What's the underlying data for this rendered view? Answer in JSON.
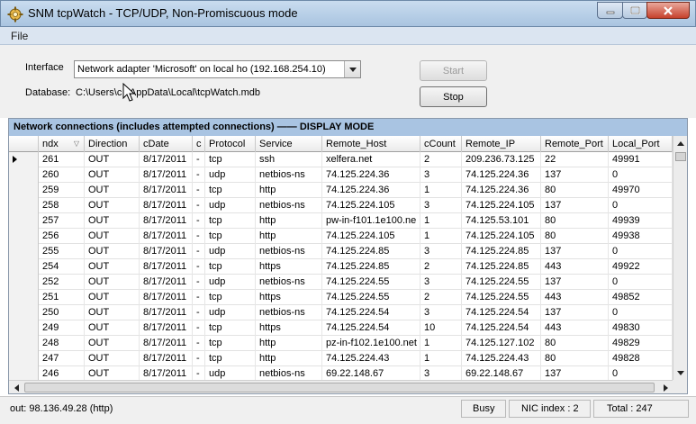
{
  "window": {
    "title": "SNM tcpWatch - TCP/UDP, Non-Promiscuous mode",
    "icons": {
      "app": "network-gear-icon",
      "minimize": "minimize-icon",
      "maximize": "maximize-icon",
      "close": "close-icon"
    }
  },
  "menu": {
    "file": "File"
  },
  "panel": {
    "interface_label": "Interface",
    "interface_value": "Network adapter 'Microsoft' on local ho (192.168.254.10)",
    "database_label": "Database:",
    "database_value": "C:\\Users\\c  i\\AppData\\Local\\tcpWatch.mdb",
    "start_label": "Start",
    "stop_label": "Stop"
  },
  "grid": {
    "caption": "Network connections (includes attempted connections)  ——  DISPLAY MODE",
    "columns": [
      "ndx",
      "Direction",
      "cDate",
      "c",
      "Protocol",
      "Service",
      "Remote_Host",
      "cCount",
      "Remote_IP",
      "Remote_Port",
      "Local_Port"
    ],
    "rows": [
      [
        "261",
        "OUT",
        "8/17/2011",
        "-",
        "tcp",
        "ssh",
        "xelfera.net",
        "2",
        "209.236.73.125",
        "22",
        "49991"
      ],
      [
        "260",
        "OUT",
        "8/17/2011",
        "-",
        "udp",
        "netbios-ns",
        "74.125.224.36",
        "3",
        "74.125.224.36",
        "137",
        "0"
      ],
      [
        "259",
        "OUT",
        "8/17/2011",
        "-",
        "tcp",
        "http",
        "74.125.224.36",
        "1",
        "74.125.224.36",
        "80",
        "49970"
      ],
      [
        "258",
        "OUT",
        "8/17/2011",
        "-",
        "udp",
        "netbios-ns",
        "74.125.224.105",
        "3",
        "74.125.224.105",
        "137",
        "0"
      ],
      [
        "257",
        "OUT",
        "8/17/2011",
        "-",
        "tcp",
        "http",
        "pw-in-f101.1e100.ne",
        "1",
        "74.125.53.101",
        "80",
        "49939"
      ],
      [
        "256",
        "OUT",
        "8/17/2011",
        "-",
        "tcp",
        "http",
        "74.125.224.105",
        "1",
        "74.125.224.105",
        "80",
        "49938"
      ],
      [
        "255",
        "OUT",
        "8/17/2011",
        "-",
        "udp",
        "netbios-ns",
        "74.125.224.85",
        "3",
        "74.125.224.85",
        "137",
        "0"
      ],
      [
        "254",
        "OUT",
        "8/17/2011",
        "-",
        "tcp",
        "https",
        "74.125.224.85",
        "2",
        "74.125.224.85",
        "443",
        "49922"
      ],
      [
        "252",
        "OUT",
        "8/17/2011",
        "-",
        "udp",
        "netbios-ns",
        "74.125.224.55",
        "3",
        "74.125.224.55",
        "137",
        "0"
      ],
      [
        "251",
        "OUT",
        "8/17/2011",
        "-",
        "tcp",
        "https",
        "74.125.224.55",
        "2",
        "74.125.224.55",
        "443",
        "49852"
      ],
      [
        "250",
        "OUT",
        "8/17/2011",
        "-",
        "udp",
        "netbios-ns",
        "74.125.224.54",
        "3",
        "74.125.224.54",
        "137",
        "0"
      ],
      [
        "249",
        "OUT",
        "8/17/2011",
        "-",
        "tcp",
        "https",
        "74.125.224.54",
        "10",
        "74.125.224.54",
        "443",
        "49830"
      ],
      [
        "248",
        "OUT",
        "8/17/2011",
        "-",
        "tcp",
        "http",
        "pz-in-f102.1e100.net",
        "1",
        "74.125.127.102",
        "80",
        "49829"
      ],
      [
        "247",
        "OUT",
        "8/17/2011",
        "-",
        "tcp",
        "http",
        "74.125.224.43",
        "1",
        "74.125.224.43",
        "80",
        "49828"
      ],
      [
        "246",
        "OUT",
        "8/17/2011",
        "-",
        "udp",
        "netbios-ns",
        "69.22.148.67",
        "3",
        "69.22.148.67",
        "137",
        "0"
      ]
    ]
  },
  "status": {
    "out": "out: 98.136.49.28 (http)",
    "busy": "Busy",
    "nic": "NIC index : 2",
    "total": "Total : 247"
  }
}
